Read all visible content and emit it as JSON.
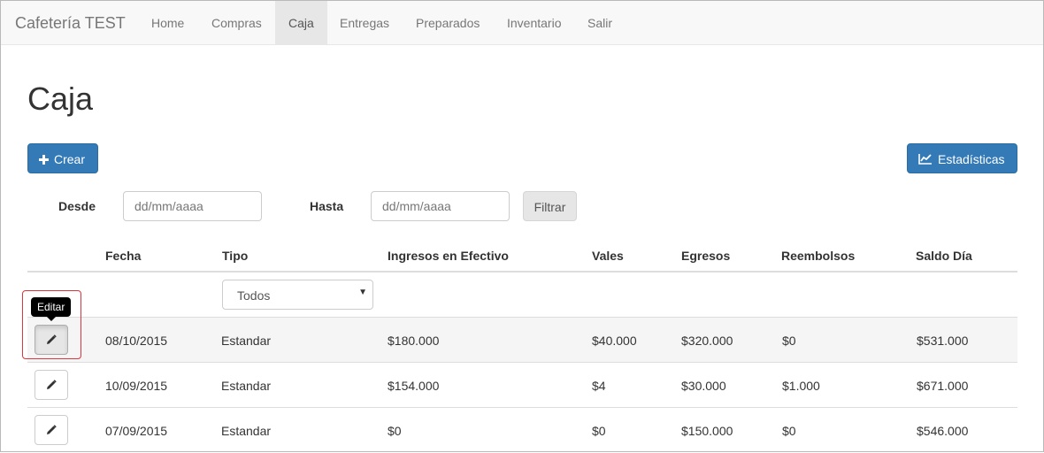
{
  "navbar": {
    "brand": "Cafetería TEST",
    "items": [
      {
        "label": "Home",
        "active": false
      },
      {
        "label": "Compras",
        "active": false
      },
      {
        "label": "Caja",
        "active": true
      },
      {
        "label": "Entregas",
        "active": false
      },
      {
        "label": "Preparados",
        "active": false
      },
      {
        "label": "Inventario",
        "active": false
      },
      {
        "label": "Salir",
        "active": false
      }
    ]
  },
  "page": {
    "title": "Caja"
  },
  "actions": {
    "create_label": "Crear",
    "stats_label": "Estadísticas"
  },
  "filters": {
    "from_label": "Desde",
    "from_placeholder": "dd/mm/aaaa",
    "to_label": "Hasta",
    "to_placeholder": "dd/mm/aaaa",
    "filter_label": "Filtrar"
  },
  "table": {
    "headers": [
      "Fecha",
      "Tipo",
      "Ingresos en Efectivo",
      "Vales",
      "Egresos",
      "Reembolsos",
      "Saldo Día"
    ],
    "type_filter": {
      "selected": "Todos"
    },
    "tooltip": "Editar",
    "rows": [
      {
        "fecha": "08/10/2015",
        "tipo": "Estandar",
        "ingresos": "$180.000",
        "vales": "$40.000",
        "egresos": "$320.000",
        "reembolsos": "$0",
        "saldo": "$531.000"
      },
      {
        "fecha": "10/09/2015",
        "tipo": "Estandar",
        "ingresos": "$154.000",
        "vales": "$4",
        "egresos": "$30.000",
        "reembolsos": "$1.000",
        "saldo": "$671.000"
      },
      {
        "fecha": "07/09/2015",
        "tipo": "Estandar",
        "ingresos": "$0",
        "vales": "$0",
        "egresos": "$150.000",
        "reembolsos": "$0",
        "saldo": "$546.000"
      }
    ]
  },
  "colors": {
    "primary": "#337ab7",
    "highlight": "#d9363e"
  }
}
